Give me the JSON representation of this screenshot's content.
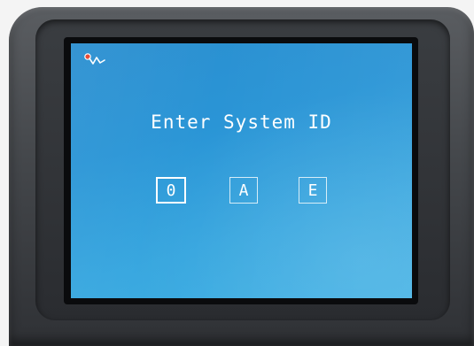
{
  "screen": {
    "title": "Enter System ID",
    "status_icon": "connection-status-icon",
    "id_fields": [
      {
        "value": "0",
        "active": true
      },
      {
        "value": "A",
        "active": false
      },
      {
        "value": "E",
        "active": false
      }
    ]
  },
  "colors": {
    "screen_background": "#2a95d6",
    "text": "#ffffff",
    "active_border": "#ffffff",
    "inactive_border": "#d4ecf8",
    "bezel": "#44474b"
  }
}
